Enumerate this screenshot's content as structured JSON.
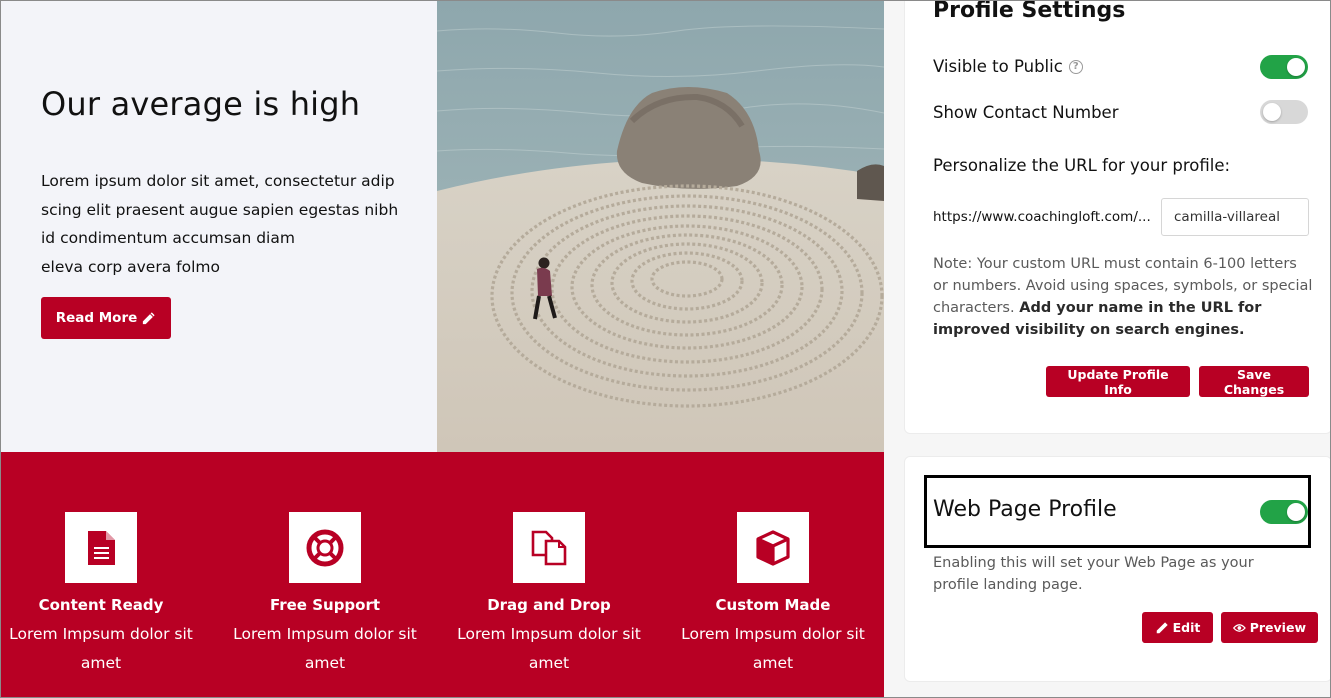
{
  "hero": {
    "title": "Our average is high",
    "body_lines": [
      "Lorem ipsum dolor sit amet, consectetur adip",
      "scing elit praesent augue sapien egestas nibh",
      "id condimentum accumsan diam",
      "eleva corp avera folmo"
    ],
    "read_more_label": "Read More",
    "read_more_icon": "pencil-icon"
  },
  "features": [
    {
      "icon": "document-icon",
      "title": "Content Ready",
      "desc": "Lorem Impsum dolor sit amet"
    },
    {
      "icon": "lifebuoy-icon",
      "title": "Free Support",
      "desc": "Lorem Impsum dolor sit amet"
    },
    {
      "icon": "copy-pages-icon",
      "title": "Drag and Drop",
      "desc": "Lorem Impsum dolor sit amet"
    },
    {
      "icon": "cube-icon",
      "title": "Custom Made",
      "desc": "Lorem Impsum dolor sit amet"
    }
  ],
  "settings": {
    "title": "Profile Settings",
    "visible_to_public": {
      "label": "Visible to Public",
      "on": true,
      "icon": "help-icon"
    },
    "show_contact_number": {
      "label": "Show Contact Number",
      "on": false
    },
    "url_heading": "Personalize the URL for your profile:",
    "url_prefix": "https://www.coachingloft.com/...",
    "url_value": "camilla-villareal",
    "note_plain": "Note: Your custom URL must contain 6-100 letters or numbers. Avoid using spaces, symbols, or special characters. ",
    "note_bold": "Add your name in the URL for improved visibility on search engines.",
    "update_label": "Update Profile Info",
    "save_label": "Save Changes"
  },
  "web_page": {
    "title": "Web Page Profile",
    "on": true,
    "desc": "Enabling this will set your Web Page as your profile landing page.",
    "edit_label": "Edit",
    "edit_icon": "pencil-icon",
    "preview_label": "Preview",
    "preview_icon": "eye-icon"
  },
  "colors": {
    "brand_red": "#b80024",
    "toggle_on": "#22a347",
    "toggle_off": "#d8d8d8",
    "hero_bg": "#f3f4f9"
  }
}
